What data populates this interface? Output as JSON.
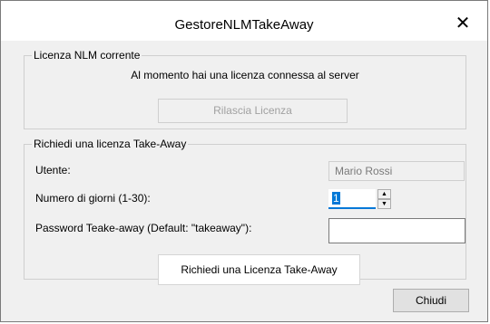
{
  "window": {
    "title": "GestoreNLMTakeAway",
    "close_glyph": "✕"
  },
  "current_license": {
    "legend": "Licenza NLM corrente",
    "message": "Al momento hai una licenza connessa al server",
    "release_button": "Rilascia Licenza"
  },
  "request_license": {
    "legend": "Richiedi una licenza Take-Away",
    "user_label": "Utente:",
    "user_value": "Mario Rossi",
    "days_label": "Numero di giorni (1-30):",
    "days_value": "1",
    "password_label": "Password Teake-away (Default: \"takeaway\"):",
    "password_value": "",
    "request_button": "Richiedi una Licenza Take-Away"
  },
  "footer": {
    "close_button": "Chiudi"
  }
}
